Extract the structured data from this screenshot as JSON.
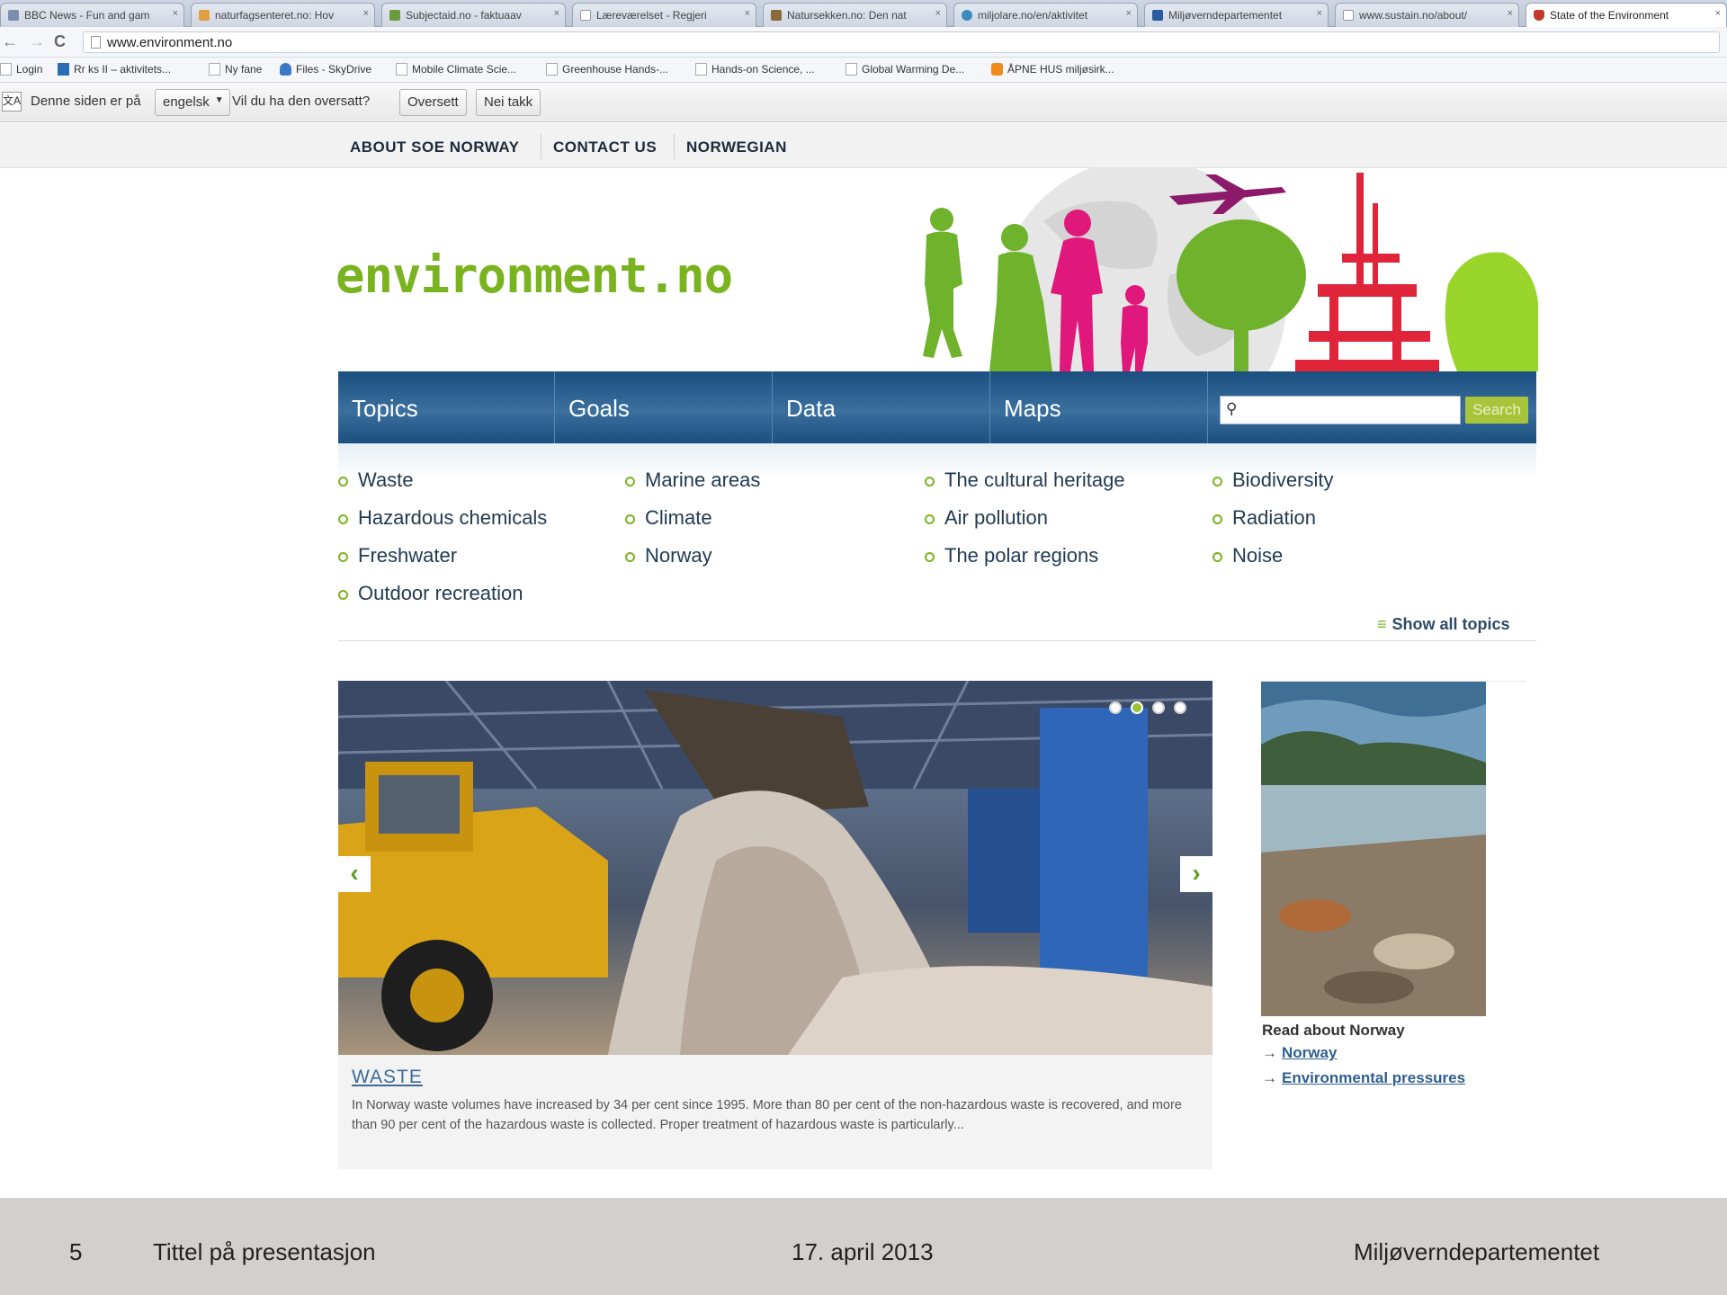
{
  "browser": {
    "tabs": [
      {
        "label": "BBC News - Fun and gam"
      },
      {
        "label": "naturfagsenteret.no: Hov"
      },
      {
        "label": "Subjectaid.no - faktuaav"
      },
      {
        "label": "Læreværelset - Regjeri"
      },
      {
        "label": "Natursekken.no: Den nat"
      },
      {
        "label": "miljolare.no/en/aktivitet"
      },
      {
        "label": "Miljøverndepartementet"
      },
      {
        "label": "www.sustain.no/about/"
      },
      {
        "label": "State of the Environment"
      }
    ],
    "url": "www.environment.no",
    "bookmarks": [
      {
        "label": "Login"
      },
      {
        "label": "Rr  ks II – aktivitets..."
      },
      {
        "label": "Ny fane"
      },
      {
        "label": "Files - SkyDrive"
      },
      {
        "label": "Mobile Climate Scie..."
      },
      {
        "label": "Greenhouse Hands-..."
      },
      {
        "label": "Hands-on Science, ..."
      },
      {
        "label": "Global Warming De..."
      },
      {
        "label": "ÅPNE HUS miljøsirk..."
      }
    ],
    "translate": {
      "prefix": "Denne siden er på",
      "language": "engelsk",
      "question": "Vil du ha den oversatt?",
      "translate_btn": "Oversett",
      "decline_btn": "Nei takk"
    }
  },
  "site": {
    "topnav": [
      "ABOUT SOE NORWAY",
      "CONTACT US",
      "NORWEGIAN"
    ],
    "logo": "environment.no",
    "mainnav": [
      "Topics",
      "Goals",
      "Data",
      "Maps"
    ],
    "search_label": "Search",
    "topics": [
      [
        "Waste",
        "Hazardous chemicals",
        "Freshwater",
        "Outdoor recreation"
      ],
      [
        "Marine areas",
        "Climate",
        "Norway"
      ],
      [
        "The cultural heritage",
        "Air pollution",
        "The polar regions"
      ],
      [
        "Biodiversity",
        "Radiation",
        "Noise"
      ]
    ],
    "show_all": "Show all topics",
    "slider": {
      "active_dot": 2,
      "dot_count": 4,
      "caption_title": "WASTE",
      "caption_text": "In Norway waste volumes have increased by 34 per cent since 1995. More than 80 per cent of the non-hazardous waste is recovered, and more than 90 per cent of the hazardous waste is collected. Proper treatment of hazardous waste is particularly..."
    },
    "side": {
      "title": "Read about Norway",
      "links": [
        "Norway",
        "Environmental pressures"
      ]
    },
    "colors": {
      "nav": "#1b4f7f",
      "accent": "#7ab320",
      "link": "#2f5f8f"
    }
  },
  "footer": {
    "page_number": "5",
    "title": "Tittel på presentasjon",
    "date": "17. april 2013",
    "org": "Miljøverndepartementet"
  }
}
